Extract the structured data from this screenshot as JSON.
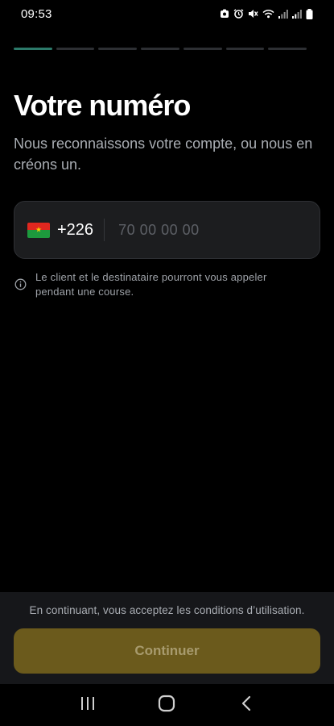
{
  "status_bar": {
    "time": "09:53",
    "icons": [
      "notification-icon",
      "alarm-icon",
      "mute-icon",
      "wifi-icon",
      "signal-icon",
      "signal-icon",
      "battery-icon"
    ]
  },
  "stepper": {
    "total_steps": 7,
    "current_step": 1,
    "active_color": "#2c7a6a"
  },
  "title": "Votre numéro",
  "subtitle": "Nous reconnaissons votre compte, ou nous en créons un.",
  "phone_field": {
    "country_flag": "burkina-faso-flag",
    "dial_code": "+226",
    "value": "",
    "placeholder": "70 00 00 00"
  },
  "info_note": {
    "icon": "info-icon",
    "text": "Le client et le destinataire pourront vous appeler pendant une course."
  },
  "footer": {
    "terms_text": "En continuant, vous acceptez les conditions d’utilisation.",
    "continue_label": "Continuer",
    "button_color": "#6b5a1c"
  },
  "nav_bar": {
    "buttons": [
      "recent-apps-icon",
      "home-icon",
      "back-icon"
    ]
  }
}
